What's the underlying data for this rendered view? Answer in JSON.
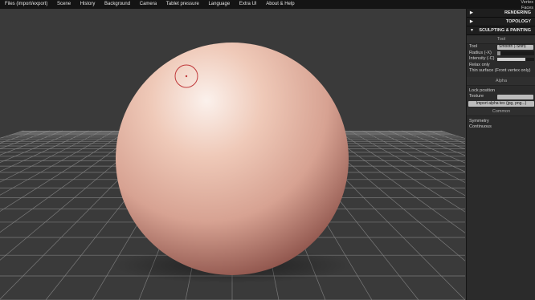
{
  "menu": {
    "items": [
      "Files (import/export)",
      "Scene",
      "History",
      "Background",
      "Camera",
      "Tablet pressure",
      "Language",
      "Extra UI",
      "About & Help"
    ],
    "vertex_label": "Vertex",
    "faces_label": "Faces"
  },
  "viewport": {
    "background_color": "#3a3a3a",
    "grid_color": "#8a8a8a",
    "brush_cursor_color": "#c0393b"
  },
  "panel": {
    "sections": {
      "rendering": "RENDERING",
      "topology": "TOPOLOGY",
      "sculpting": "SCULPTING & PAINTING"
    },
    "tool_title": "Tool",
    "tool_label": "Tool",
    "tool_value": "Smooth (-Shift)",
    "radius_label": "Radius (-X)",
    "radius_level": 0.08,
    "intensity_label": "Intensity (-C)",
    "intensity_level": 0.75,
    "relax_only_label": "Relax only",
    "thin_surface_label": "Thin surface (Front vertex only)",
    "alpha_title": "Alpha",
    "lock_position_label": "Lock position",
    "texture_label": "Texture",
    "import_alpha_label": "Import alpha tex (jpg, png...)",
    "common_title": "Common",
    "symmetry_label": "Symmetry",
    "continuous_label": "Continuous"
  }
}
